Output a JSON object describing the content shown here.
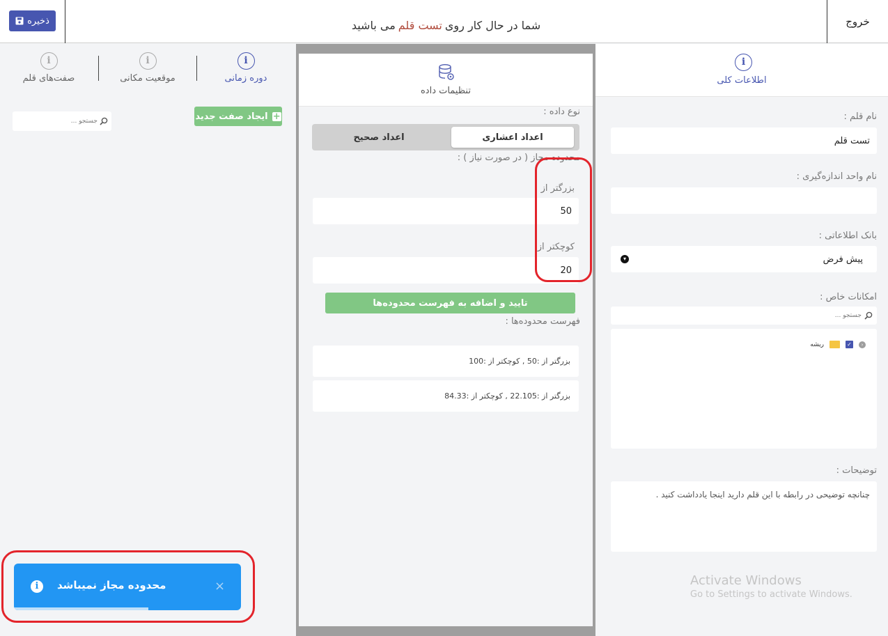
{
  "topbar": {
    "save_label": "ذخیره",
    "exit_label": "خروج",
    "headline_pre": "شما در حال کار روی",
    "headline_pen": "تست قلم",
    "headline_post": "می باشید"
  },
  "left": {
    "tabs": [
      {
        "label": "دوره زمانی",
        "active": true
      },
      {
        "label": "موقعیت مکانی",
        "active": false
      },
      {
        "label": "صفت‌های قلم",
        "active": false
      }
    ],
    "new_attribute_label": "ایجاد صفت جدید",
    "search_placeholder": "جستجو ..."
  },
  "toast": {
    "message": "محدوده مجاز نمیباشد",
    "close_glyph": "×",
    "color": "#2296f3"
  },
  "middle": {
    "title": "تنظیمات داده",
    "data_type_label": "نوع داده :",
    "data_type_options": [
      "اعداد اعشاری",
      "اعداد صحیح"
    ],
    "data_type_selected": "اعداد اعشاری",
    "range_label": "محدوده مجاز ( در صورت نیاز ) :",
    "greater_label": "بزرگتر از",
    "greater_value": "50",
    "less_label": "کوچکتر از",
    "less_value": "20",
    "confirm_label": "تایید و اضافه به فهرست محدوده‌ها",
    "list_label": "فهرست محدوده‌ها :",
    "ranges": [
      "بزرگتر از :50 , کوچکتر از :100",
      "بزرگتر از :22.105 , کوچکتر از :84.33"
    ]
  },
  "right": {
    "title": "اطلاعات کلی",
    "name_label": "نام قلم :",
    "name_value": "تست قلم",
    "unit_label": "نام واحد اندازه‌گیری :",
    "unit_value": "",
    "db_label": "بانک اطلاعاتی :",
    "db_value": "پیش فرض",
    "features_label": "امکانات خاص :",
    "features_search_placeholder": "جستجو ...",
    "tree_root": "ریشه",
    "desc_label": "توضیحات :",
    "desc_placeholder": "چنانچه توضیحی در رابطه با این قلم دارید اینجا یادداشت کنید ."
  },
  "watermark": {
    "line1": "Activate Windows",
    "line2": "Go to Settings to activate Windows."
  },
  "colors": {
    "accent": "#4756b0",
    "success": "#81c784",
    "highlight": "#e3242b",
    "pen_name": "#b04a3b"
  }
}
